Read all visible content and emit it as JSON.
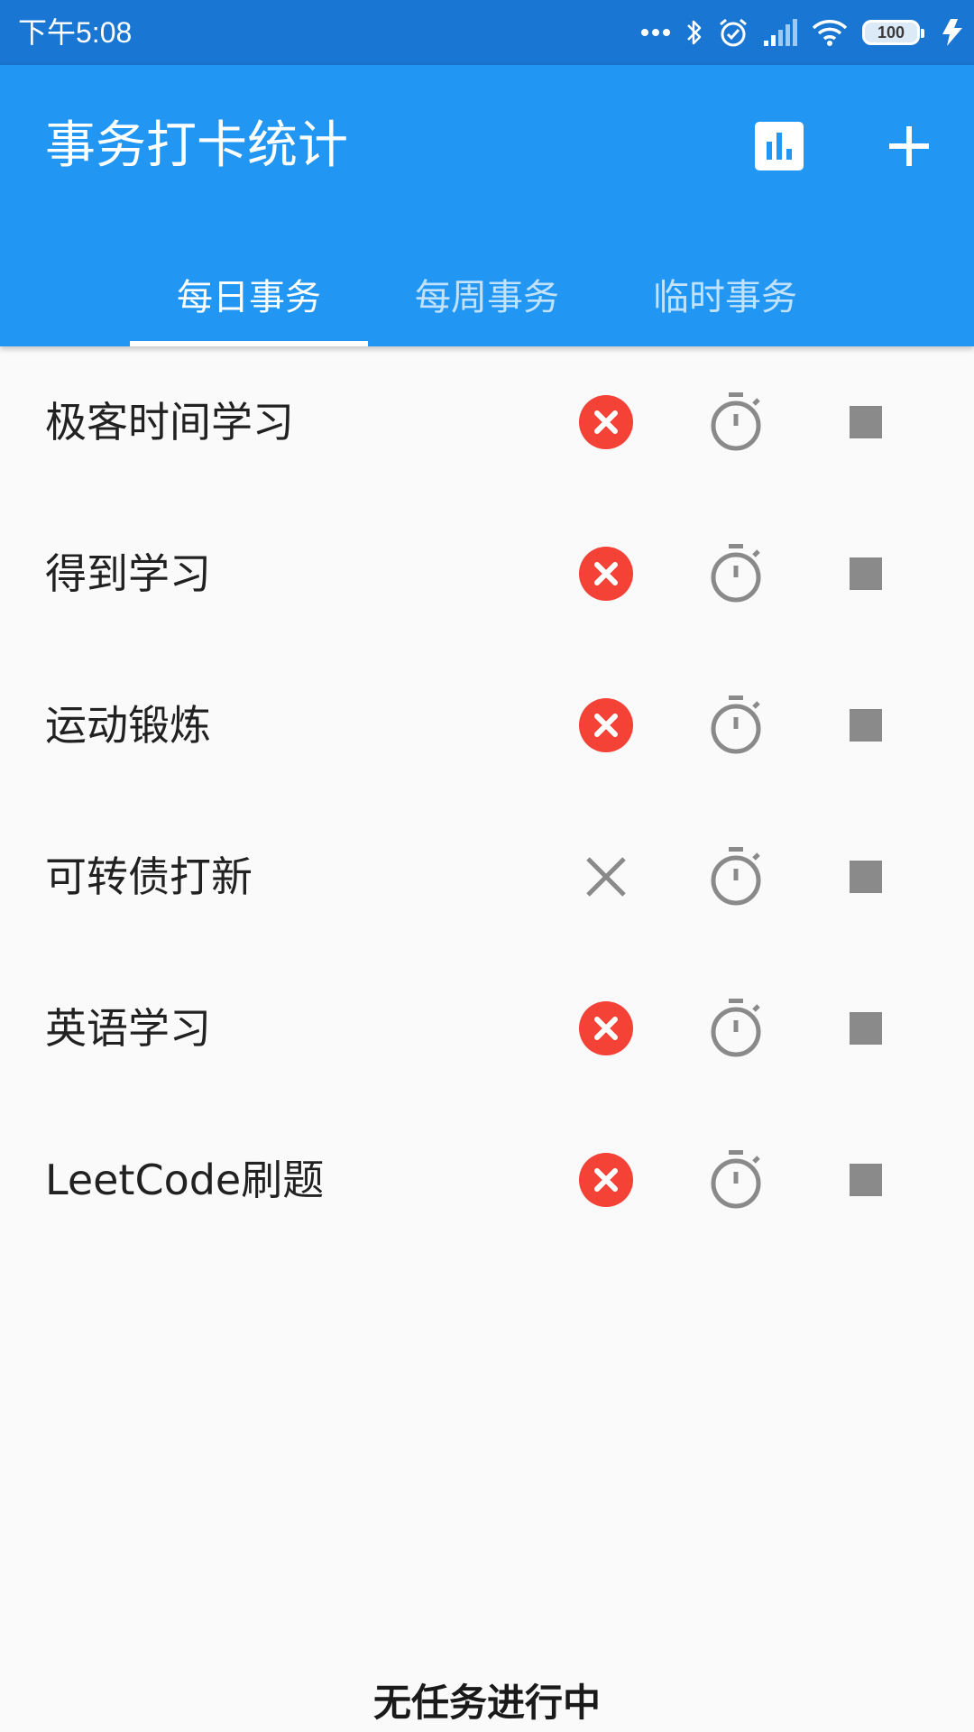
{
  "status_bar": {
    "time": "下午5:08",
    "battery": "100",
    "icons": [
      "more-dots-icon",
      "bluetooth-icon",
      "alarm-icon",
      "signal-icon",
      "wifi-icon",
      "battery-icon",
      "charging-icon"
    ]
  },
  "app_bar": {
    "title": "事务打卡统计",
    "actions": [
      "bar-chart-icon",
      "add-icon"
    ]
  },
  "tabs": [
    {
      "label": "每日事务",
      "selected": true
    },
    {
      "label": "每周事务",
      "selected": false
    },
    {
      "label": "临时事务",
      "selected": false
    }
  ],
  "tasks": [
    {
      "name": "极客时间学习",
      "cancel_state": "red-filled"
    },
    {
      "name": "得到学习",
      "cancel_state": "red-filled"
    },
    {
      "name": "运动锻炼",
      "cancel_state": "red-filled"
    },
    {
      "name": "可转债打新",
      "cancel_state": "gray-outline"
    },
    {
      "name": "英语学习",
      "cancel_state": "red-filled"
    },
    {
      "name": "LeetCode刷题",
      "cancel_state": "red-filled"
    }
  ],
  "footer": {
    "status": "无任务进行中"
  },
  "colors": {
    "status_bar": "#1976d2",
    "primary": "#2196f3",
    "cancel_red": "#f44336",
    "icon_gray": "#8a8a8a",
    "background": "#fafafa"
  }
}
